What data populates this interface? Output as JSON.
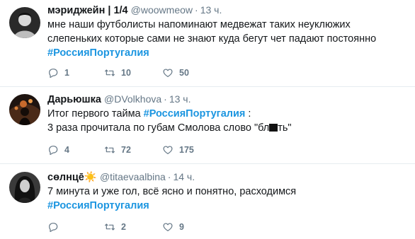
{
  "tweets": [
    {
      "name": "мэриджейн | 1/4",
      "handle": "@woowmeow",
      "time": "13 ч.",
      "line1": "мне наши футболисты напоминают медвежат таких неуклюжих",
      "line2": "слепеньких которые сами не знают куда бегут чет падают постоянно",
      "hashtag": "#РоссияПортугалия",
      "replies": "1",
      "retweets": "10",
      "likes": "50"
    },
    {
      "name": "Дарьюшка",
      "handle": "@DVolkhova",
      "time": "13 ч.",
      "line1_pre": "Итог первого тайма ",
      "hashtag": "#РоссияПортугалия",
      "line1_post": " :",
      "line2_pre": "3 раза прочитала по губам Смолова слово \"бл",
      "line2_post": "ть\"",
      "replies": "4",
      "retweets": "72",
      "likes": "175"
    },
    {
      "name": "сөлнцē",
      "name_emoji": "☀️",
      "handle": "@titaevaalbina",
      "time": "14 ч.",
      "line1": "7 минута и уже гол, всё ясно и понятно, расходимся",
      "hashtag": "#РоссияПортугалия",
      "replies": "",
      "retweets": "2",
      "likes": "9"
    }
  ],
  "icons": {
    "reply": "reply-icon",
    "retweet": "retweet-icon",
    "like": "heart-icon"
  },
  "colors": {
    "hashtag": "#1b95e0",
    "meta": "#657786",
    "divider": "#e6ecf0"
  }
}
